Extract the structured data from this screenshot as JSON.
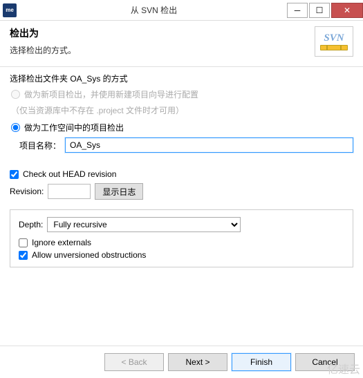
{
  "titlebar": {
    "icon_text": "me",
    "title": "从 SVN 检出"
  },
  "header": {
    "title": "检出为",
    "subtitle": "选择检出的方式。",
    "logo_text": "SVN"
  },
  "section": {
    "prompt": "选择检出文件夹 OA_Sys 的方式",
    "option1": "做为新项目检出，并使用新建项目向导进行配置",
    "option1_hint": "（仅当资源库中不存在 .project 文件时才可用）",
    "option2": "做为工作空间中的项目检出"
  },
  "project": {
    "label": "项目名称：",
    "value": "OA_Sys"
  },
  "revision": {
    "check_head": "Check out HEAD revision",
    "label": "Revision:",
    "value": "",
    "showlog": "显示日志"
  },
  "depth": {
    "label": "Depth:",
    "value": "Fully recursive",
    "ignore_externals": "Ignore externals",
    "allow_unversioned": "Allow unversioned obstructions"
  },
  "buttons": {
    "back": "< Back",
    "next": "Next >",
    "finish": "Finish",
    "cancel": "Cancel"
  },
  "watermark": "亿速云"
}
